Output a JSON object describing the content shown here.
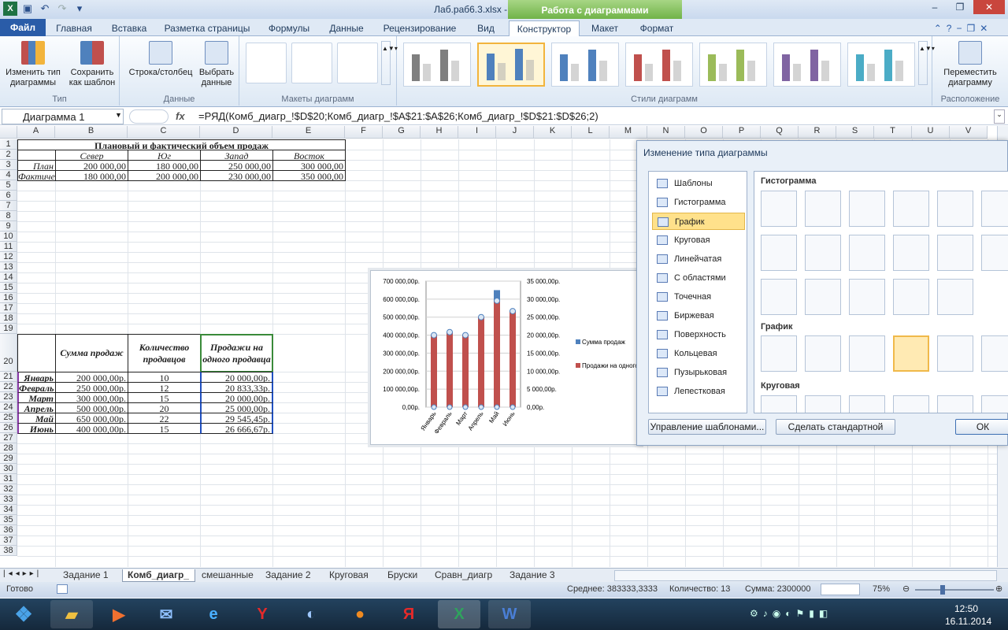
{
  "window": {
    "title": "Лаб.раб6.3.xlsx - Microsoft Excel",
    "context_header": "Работа с диаграммами",
    "controls": [
      "–",
      "❐",
      "✕"
    ]
  },
  "tabs": [
    {
      "label": "Файл"
    },
    {
      "label": "Главная"
    },
    {
      "label": "Вставка"
    },
    {
      "label": "Разметка страницы"
    },
    {
      "label": "Формулы"
    },
    {
      "label": "Данные"
    },
    {
      "label": "Рецензирование"
    },
    {
      "label": "Вид"
    },
    {
      "label": "Конструктор"
    },
    {
      "label": "Макет"
    },
    {
      "label": "Формат"
    }
  ],
  "ribbon": {
    "g1": {
      "b1": "Изменить тип диаграммы",
      "b2": "Сохранить как шаблон",
      "label": "Тип"
    },
    "g2": {
      "b1": "Строка/столбец",
      "b2": "Выбрать данные",
      "label": "Данные"
    },
    "g3": {
      "label": "Макеты диаграмм"
    },
    "g4": {
      "label": "Стили диаграмм"
    },
    "g5": {
      "b1": "Переместить диаграмму",
      "label": "Расположение"
    },
    "style_colors": [
      "#7f7f7f",
      "#4f81bd",
      "#4f81bd",
      "#c0504d",
      "#9bbb59",
      "#8064a2",
      "#4bacc6"
    ]
  },
  "formula": {
    "name_box": "Диаграмма 1",
    "fx": "fx",
    "value": "=РЯД(Комб_диагр_!$D$20;Комб_диагр_!$A$21:$A$26;Комб_диагр_!$D$21:$D$26;2)"
  },
  "columns": [
    "A",
    "B",
    "C",
    "D",
    "E",
    "F",
    "G",
    "H",
    "I",
    "J",
    "K",
    "L",
    "M",
    "N",
    "O",
    "P",
    "Q",
    "R",
    "S",
    "T",
    "U",
    "V"
  ],
  "rows": [
    "1",
    "2",
    "3",
    "4",
    "5",
    "6",
    "7",
    "8",
    "9",
    "10",
    "11",
    "12",
    "13",
    "14",
    "15",
    "16",
    "17",
    "18",
    "19",
    "20",
    "21",
    "22",
    "23",
    "24",
    "25",
    "26",
    "27",
    "28",
    "29",
    "30",
    "31",
    "32",
    "33",
    "34",
    "35",
    "36",
    "37",
    "38"
  ],
  "table1": {
    "title": "Плановый и фактический объем продаж",
    "headers": [
      "Север",
      "Юг",
      "Запад",
      "Восток"
    ],
    "rows": [
      {
        "label": "План",
        "v": [
          "200 000,00",
          "180 000,00",
          "250 000,00",
          "300 000,00"
        ]
      },
      {
        "label": "Фактически",
        "v": [
          "180 000,00",
          "200 000,00",
          "230 000,00",
          "350 000,00"
        ]
      }
    ]
  },
  "table2": {
    "headers": [
      "Сумма продаж",
      "Количество продавцов",
      "Продажи на одного продавца"
    ],
    "rows": [
      {
        "m": "Январь",
        "s": "200 000,00р.",
        "c": "10",
        "p": "20 000,00р."
      },
      {
        "m": "Февраль",
        "s": "250 000,00р.",
        "c": "12",
        "p": "20 833,33р."
      },
      {
        "m": "Март",
        "s": "300 000,00р.",
        "c": "15",
        "p": "20 000,00р."
      },
      {
        "m": "Апрель",
        "s": "500 000,00р.",
        "c": "20",
        "p": "25 000,00р."
      },
      {
        "m": "Май",
        "s": "650 000,00р.",
        "c": "22",
        "p": "29 545,45р."
      },
      {
        "m": "Июнь",
        "s": "400 000,00р.",
        "c": "15",
        "p": "26 666,67р."
      }
    ]
  },
  "chart_data": {
    "type": "bar",
    "categories": [
      "Январь",
      "Февраль",
      "Март",
      "Апрель",
      "Май",
      "Июнь"
    ],
    "series": [
      {
        "name": "Сумма продаж",
        "values": [
          200000,
          250000,
          300000,
          500000,
          650000,
          400000
        ],
        "color": "#4f81bd"
      },
      {
        "name": "Продажи на одного продавца",
        "values": [
          20000,
          20833.33,
          20000,
          25000,
          29545.45,
          26666.67
        ],
        "color": "#c0504d"
      }
    ],
    "ylim": [
      0,
      700000
    ],
    "y2lim": [
      0,
      35000
    ],
    "yticks": [
      "0,00р.",
      "100 000,00р.",
      "200 000,00р.",
      "300 000,00р.",
      "400 000,00р.",
      "500 000,00р.",
      "600 000,00р.",
      "700 000,00р."
    ],
    "y2ticks": [
      "0,00р.",
      "5 000,00р.",
      "10 000,00р.",
      "15 000,00р.",
      "20 000,00р.",
      "25 000,00р.",
      "30 000,00р.",
      "35 000,00р."
    ],
    "legend": "right"
  },
  "dialog": {
    "title": "Изменение типа диаграммы",
    "types": [
      "Шаблоны",
      "Гистограмма",
      "График",
      "Круговая",
      "Линейчатая",
      "С областями",
      "Точечная",
      "Биржевая",
      "Поверхность",
      "Кольцевая",
      "Пузырьковая",
      "Лепестковая"
    ],
    "selected_type": "График",
    "sections": [
      "Гистограмма",
      "График",
      "Круговая"
    ],
    "buttons": {
      "manage": "Управление шаблонами...",
      "default": "Сделать стандартной",
      "ok": "ОК"
    }
  },
  "sheets": [
    "Задание 1",
    "Комб_диагр_",
    "смешанные",
    "Задание 2",
    "Круговая",
    "Бруски",
    "Сравн_диагр",
    "Задание 3"
  ],
  "active_sheet": "Комб_диагр_",
  "status": {
    "ready": "Готово",
    "avg": "Среднее: 383333,3333",
    "count": "Количество: 13",
    "sum": "Сумма: 2300000",
    "zoom": "75%"
  },
  "taskbar": {
    "time": "12:50",
    "date": "16.11.2014"
  }
}
